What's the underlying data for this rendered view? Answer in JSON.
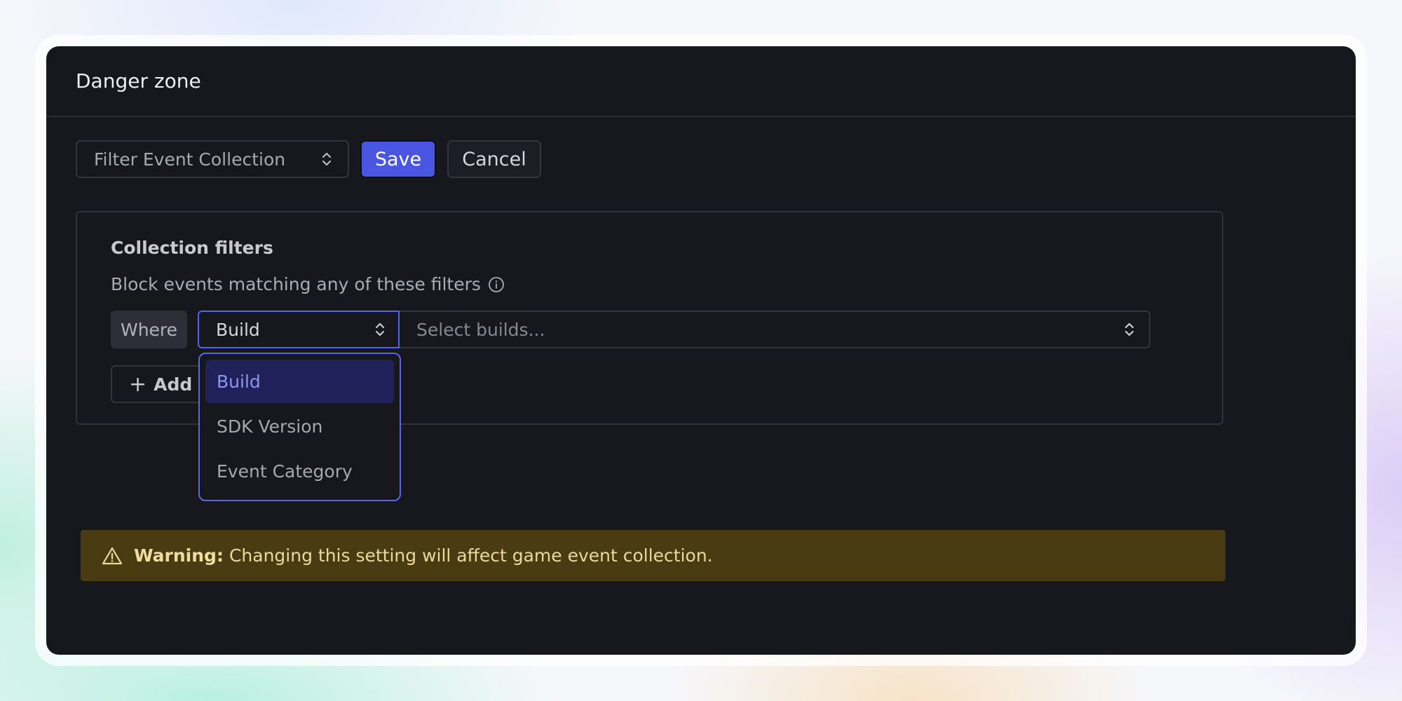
{
  "header": {
    "title": "Danger zone"
  },
  "toolbar": {
    "mode_select_value": "Filter Event Collection",
    "save_label": "Save",
    "cancel_label": "Cancel"
  },
  "filters": {
    "title": "Collection filters",
    "description": "Block events matching any of these filters",
    "where_label": "Where",
    "field_value": "Build",
    "value_placeholder": "Select builds...",
    "add_filter_label": "Add filter"
  },
  "dropdown": {
    "options": [
      {
        "label": "Build",
        "selected": true
      },
      {
        "label": "SDK Version",
        "selected": false
      },
      {
        "label": "Event Category",
        "selected": false
      }
    ]
  },
  "warning": {
    "prefix": "Warning:",
    "message": "Changing this setting will affect game event collection."
  },
  "colors": {
    "accent": "#4a56e1",
    "panel_bg": "#17181e",
    "warning_bg": "#4a3c12"
  },
  "icons": [
    "chevron-up-down-icon",
    "info-icon",
    "plus-icon",
    "warning-icon"
  ]
}
